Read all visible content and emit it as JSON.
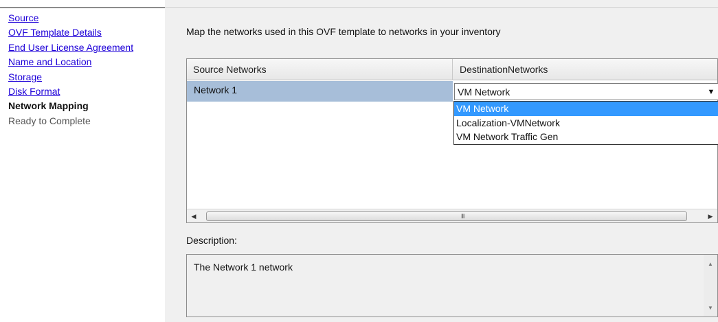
{
  "nav": {
    "items": [
      {
        "label": "Source",
        "state": "link"
      },
      {
        "label": "OVF Template Details",
        "state": "link"
      },
      {
        "label": "End User License Agreement",
        "state": "link"
      },
      {
        "label": "Name and Location",
        "state": "link"
      },
      {
        "label": "Storage",
        "state": "link"
      },
      {
        "label": "Disk Format",
        "state": "link"
      },
      {
        "label": "Network Mapping",
        "state": "current"
      },
      {
        "label": "Ready to Complete",
        "state": "pending"
      }
    ]
  },
  "main": {
    "instruction": "Map the networks used in this OVF template to networks in your inventory",
    "grid": {
      "columns": [
        "Source Networks",
        "DestinationNetworks"
      ],
      "rows": [
        {
          "source": "Network 1",
          "destination": "VM Network"
        }
      ]
    },
    "dropdown": {
      "options": [
        "VM Network",
        "Localization-VMNetwork",
        "VM Network Traffic Gen"
      ],
      "selected_index": 0
    },
    "scrollbar": {
      "grip": "III"
    },
    "description": {
      "label": "Description:",
      "text": "The Network 1 network"
    }
  },
  "colors": {
    "link": "#1d00d8",
    "row_highlight": "#a7bed9",
    "selection": "#3399ff",
    "panel_bg": "#f0f0f0"
  },
  "icons": {
    "combo_arrow": "chevron-down-icon",
    "scroll_left": "arrow-left-icon",
    "scroll_right": "arrow-right-icon",
    "scroll_up": "arrow-up-icon",
    "scroll_down": "arrow-down-icon"
  }
}
